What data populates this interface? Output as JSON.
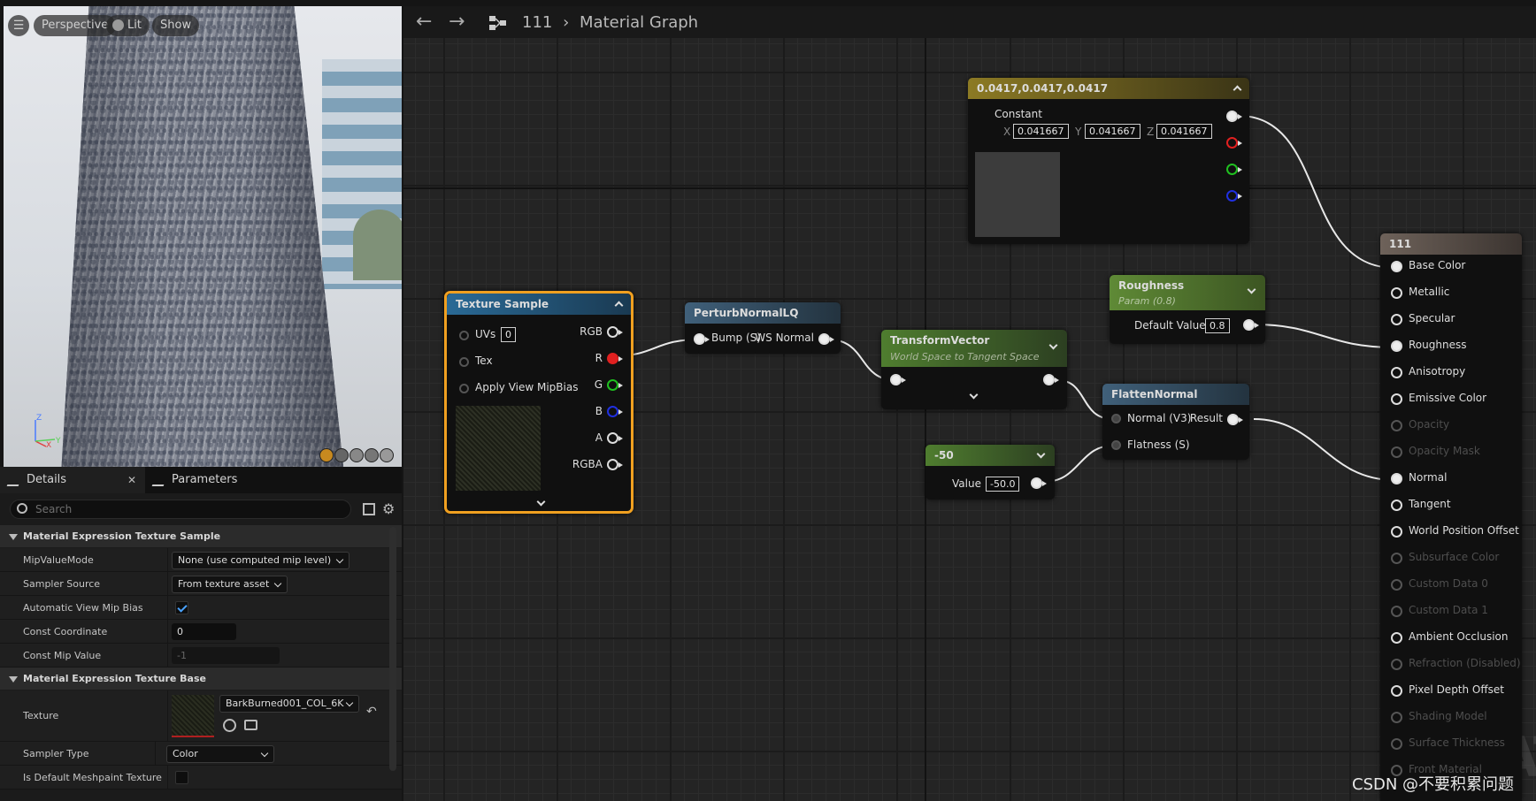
{
  "viewport": {
    "buttons": [
      "Perspective",
      "Lit",
      "Show"
    ],
    "axis_labels": [
      "Z",
      "X",
      "Y"
    ]
  },
  "details": {
    "tabs": [
      {
        "label": "Details"
      },
      {
        "label": "Parameters"
      }
    ],
    "search_placeholder": "Search",
    "sections": [
      {
        "title": "Material Expression Texture Sample"
      },
      {
        "title": "Material Expression Texture Base"
      }
    ],
    "props": {
      "mip_value_mode": {
        "label": "MipValueMode",
        "value": "None (use computed mip level)"
      },
      "sampler_source": {
        "label": "Sampler Source",
        "value": "From texture asset"
      },
      "auto_mip_bias": {
        "label": "Automatic View Mip Bias",
        "checked": true
      },
      "const_coordinate": {
        "label": "Const Coordinate",
        "value": "0"
      },
      "const_mip_value": {
        "label": "Const Mip Value",
        "value": "-1"
      },
      "texture": {
        "label": "Texture",
        "value": "BarkBurned001_COL_6K"
      },
      "sampler_type": {
        "label": "Sampler Type",
        "value": "Color"
      },
      "default_meshpaint": {
        "label": "Is Default Meshpaint Texture",
        "checked": false
      }
    }
  },
  "graph": {
    "breadcrumb": [
      "111",
      "Material Graph"
    ],
    "nodes": {
      "constant": {
        "title": "0.0417,0.0417,0.0417",
        "label": "Constant",
        "x_label": "X",
        "x": "0.041667",
        "y_label": "Y",
        "y": "0.041667",
        "z_label": "Z",
        "z": "0.041667"
      },
      "texture_sample": {
        "title": "Texture Sample",
        "inputs": [
          "UVs",
          "Tex",
          "Apply View MipBias"
        ],
        "uvs_value": "0",
        "outputs": [
          "RGB",
          "R",
          "G",
          "B",
          "A",
          "RGBA"
        ]
      },
      "perturb": {
        "title": "PerturbNormalLQ",
        "input": "Bump (S)",
        "output": "WS Normal"
      },
      "transform": {
        "title": "TransformVector",
        "subtitle": "World Space to Tangent Space"
      },
      "roughness": {
        "title": "Roughness",
        "subtitle": "Param (0.8)",
        "label": "Default Value",
        "value": "0.8"
      },
      "flatten": {
        "title": "FlattenNormal",
        "inputs": [
          "Normal (V3)",
          "Flatness (S)"
        ],
        "output": "Result"
      },
      "neg50": {
        "title": "-50",
        "label": "Value",
        "value": "-50.0"
      },
      "result": {
        "title": "111",
        "pins": [
          {
            "label": "Base Color",
            "active": true
          },
          {
            "label": "Metallic",
            "active": true
          },
          {
            "label": "Specular",
            "active": true
          },
          {
            "label": "Roughness",
            "active": true
          },
          {
            "label": "Anisotropy",
            "active": true
          },
          {
            "label": "Emissive Color",
            "active": true
          },
          {
            "label": "Opacity",
            "active": false
          },
          {
            "label": "Opacity Mask",
            "active": false
          },
          {
            "label": "Normal",
            "active": true
          },
          {
            "label": "Tangent",
            "active": true
          },
          {
            "label": "World Position Offset",
            "active": true
          },
          {
            "label": "Subsurface Color",
            "active": false
          },
          {
            "label": "Custom Data 0",
            "active": false
          },
          {
            "label": "Custom Data 1",
            "active": false
          },
          {
            "label": "Ambient Occlusion",
            "active": true
          },
          {
            "label": "Refraction (Disabled)",
            "active": false
          },
          {
            "label": "Pixel Depth Offset",
            "active": true
          },
          {
            "label": "Shading Model",
            "active": false
          },
          {
            "label": "Surface Thickness",
            "active": false
          },
          {
            "label": "Front Material",
            "active": false
          }
        ]
      }
    },
    "background_text": "MATI",
    "watermark": "CSDN @不要积累问题"
  },
  "colors": {
    "selected_orange": "#f0a020",
    "texture_header": "#2a6a96",
    "function_header": "#40607a",
    "param_green": "#4f7d2f",
    "constant_gold": "#8c7a24",
    "result_header": "#6e625a"
  }
}
